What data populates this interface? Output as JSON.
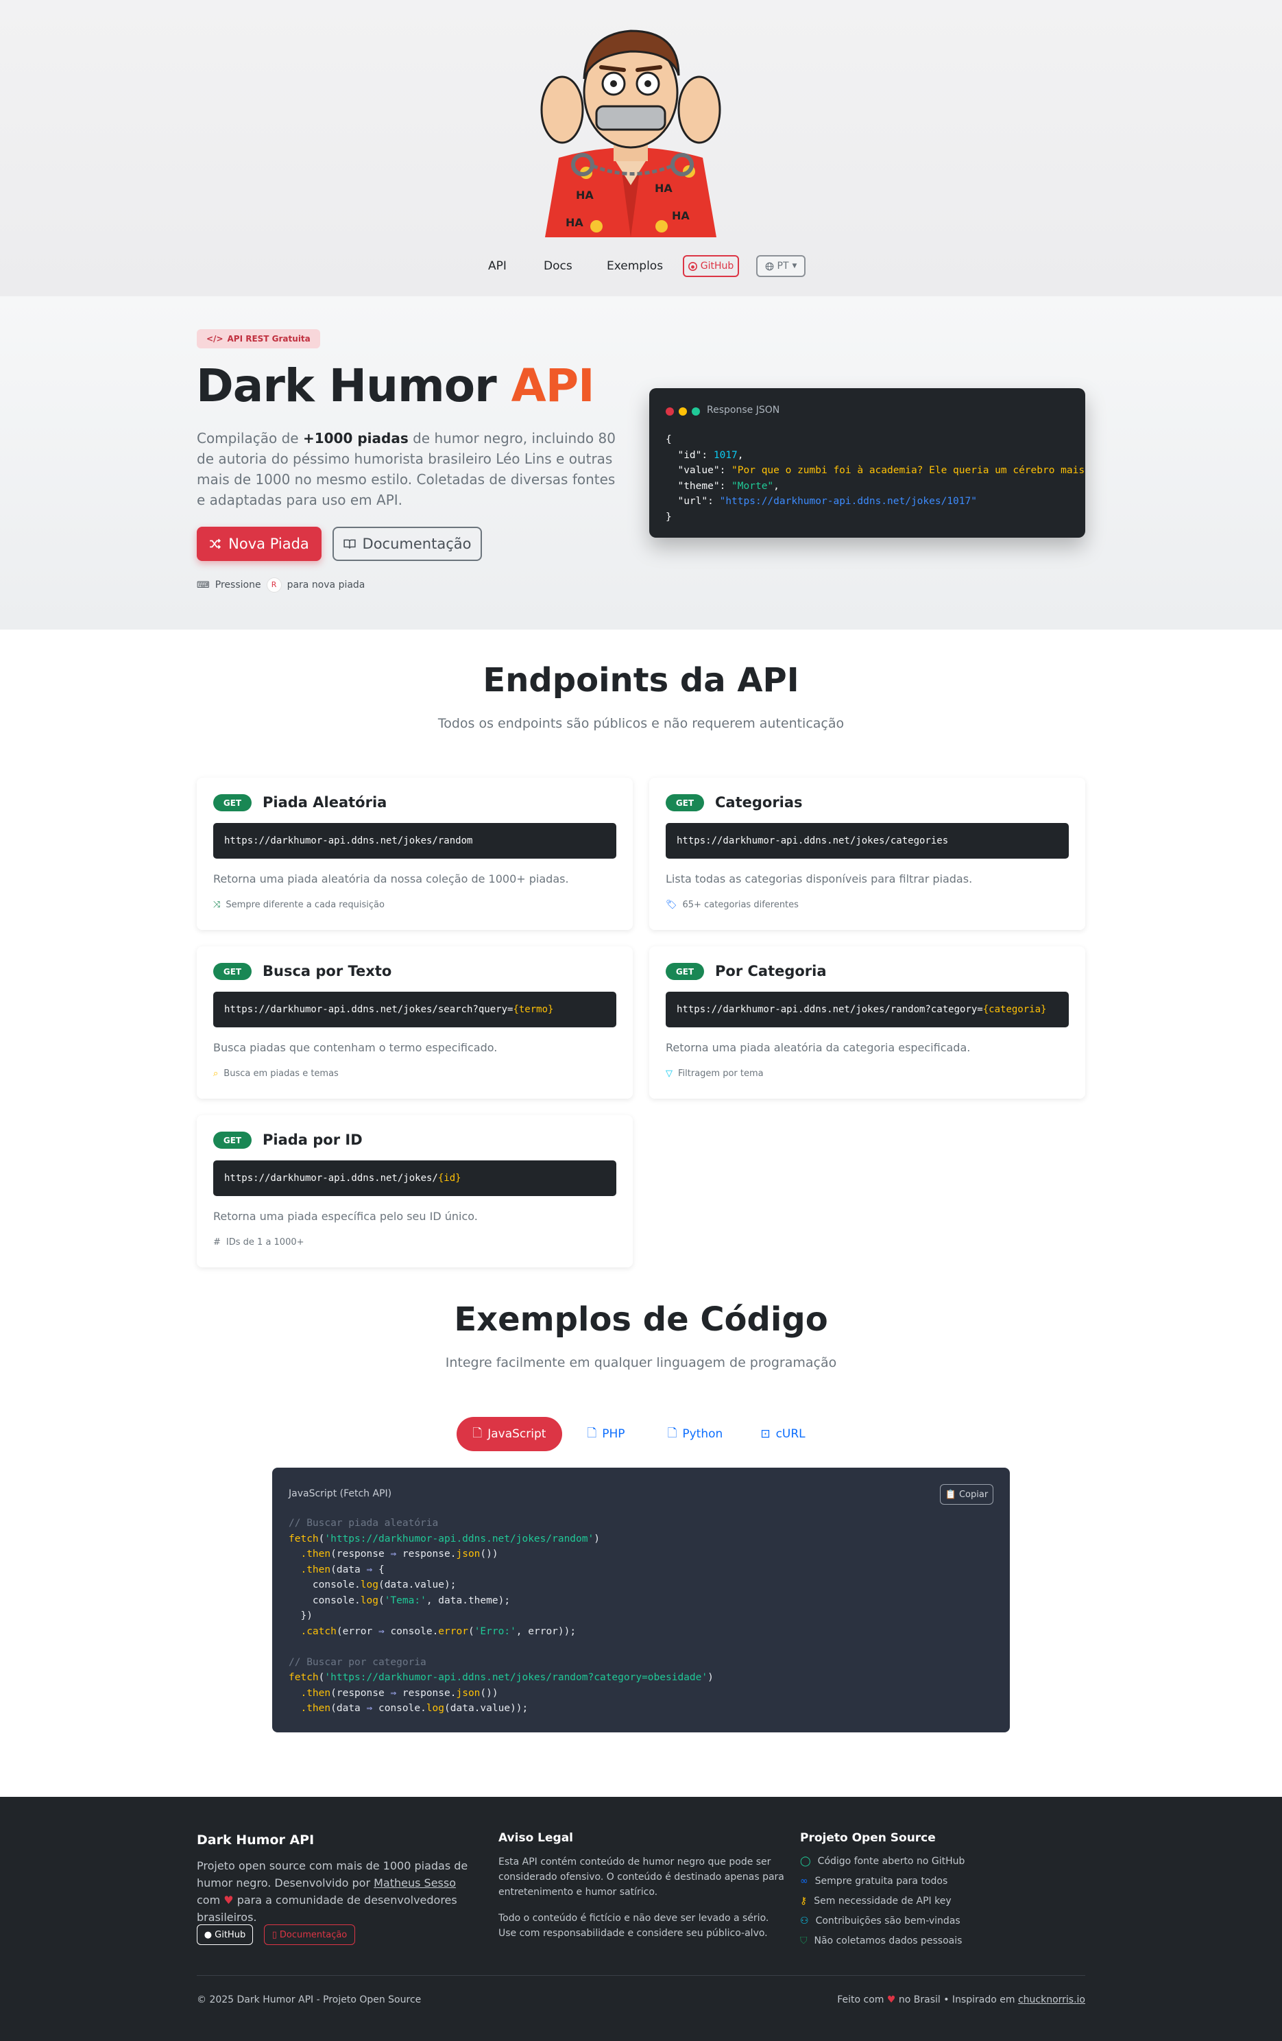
{
  "nav": {
    "links": [
      "API",
      "Docs",
      "Exemplos"
    ],
    "github": "GitHub",
    "language": "PT"
  },
  "hero": {
    "badge": "API REST Gratuita",
    "title_main": "Dark Humor ",
    "title_accent": "API",
    "lead_pre": "Compilação de ",
    "lead_bold": "+1000 piadas",
    "lead_post": " de humor negro, incluindo 80 de autoria do péssimo humorista brasileiro Léo Lins e outras mais de 1000 no mesmo estilo. Coletadas de diversas fontes e adaptadas para uso em API.",
    "btn_primary": "Nova Piada",
    "btn_secondary": "Documentação",
    "hint_pre": "Pressione",
    "hint_key": "R",
    "hint_post": "para nova piada"
  },
  "json_card": {
    "title": "Response JSON",
    "open": "{",
    "id_key": "\"id\"",
    "id_val": "1017",
    "value_key": "\"value\"",
    "value_val": "\"Por que o zumbi foi à academia? Ele queria um cérebro mais",
    "theme_key": "\"theme\"",
    "theme_val": "\"Morte\"",
    "url_key": "\"url\"",
    "url_val": "\"https://darkhumor-api.ddns.net/jokes/1017\"",
    "close": "}"
  },
  "endpoints": {
    "title": "Endpoints da API",
    "subtitle": "Todos os endpoints são públicos e não requerem autenticação",
    "method": "GET",
    "items": [
      {
        "title": "Piada Aleatória",
        "url": "https://darkhumor-api.ddns.net/jokes/random",
        "param": "",
        "desc": "Retorna uma piada aleatória da nossa coleção de 1000+ piadas.",
        "meta": "Sempre diferente a cada requisição"
      },
      {
        "title": "Categorias",
        "url": "https://darkhumor-api.ddns.net/jokes/categories",
        "param": "",
        "desc": "Lista todas as categorias disponíveis para filtrar piadas.",
        "meta": "65+ categorias diferentes"
      },
      {
        "title": "Busca por Texto",
        "url": "https://darkhumor-api.ddns.net/jokes/search?query=",
        "param": "{termo}",
        "desc": "Busca piadas que contenham o termo especificado.",
        "meta": "Busca em piadas e temas"
      },
      {
        "title": "Por Categoria",
        "url": "https://darkhumor-api.ddns.net/jokes/random?category=",
        "param": "{categoria}",
        "desc": "Retorna uma piada aleatória da categoria especificada.",
        "meta": "Filtragem por tema"
      },
      {
        "title": "Piada por ID",
        "url": "https://darkhumor-api.ddns.net/jokes/",
        "param": "{id}",
        "desc": "Retorna uma piada específica pelo seu ID único.",
        "meta": "IDs de 1 a 1000+"
      }
    ]
  },
  "examples": {
    "title": "Exemplos de Código",
    "subtitle": "Integre facilmente em qualquer linguagem de programação",
    "tabs": [
      "JavaScript",
      "PHP",
      "Python",
      "cURL"
    ],
    "code_title": "JavaScript (Fetch API)",
    "copy": "Copiar",
    "c1": "// Buscar piada aleatória",
    "l_fetch": "fetch",
    "s_url1": "'https://darkhumor-api.ddns.net/jokes/random'",
    "l_then": ".then",
    "l_response": "response",
    "l_json": "json",
    "l_data": "data",
    "l_console": "console",
    "l_log": "log",
    "s_tema": "'Tema:'",
    "l_catch": ".catch",
    "l_error": "error",
    "s_erro": "'Erro:'",
    "c2": "// Buscar por categoria",
    "s_url2": "'https://darkhumor-api.ddns.net/jokes/random?category=obesidade'",
    "t_value": "value",
    "t_theme": "theme"
  },
  "footer": {
    "about_title": "Dark Humor API",
    "about_pre": "Projeto open source com mais de 1000 piadas de humor negro. Desenvolvido por ",
    "about_author": "Matheus Sesso",
    "about_mid": " com ",
    "about_post": " para a comunidade de desenvolvedores brasileiros.",
    "btn_github": "GitHub",
    "btn_docs": "Documentação",
    "legal_title": "Aviso Legal",
    "legal_p1": "Esta API contém conteúdo de humor negro que pode ser considerado ofensivo. O conteúdo é destinado apenas para entretenimento e humor satírico.",
    "legal_p2": "Todo o conteúdo é fictício e não deve ser levado a sério. Use com responsabilidade e considere seu público-alvo.",
    "os_title": "Projeto Open Source",
    "os_items": [
      "Código fonte aberto no GitHub",
      "Sempre gratuita para todos",
      "Sem necessidade de API key",
      "Contribuições são bem-vindas",
      "Não coletamos dados pessoais"
    ],
    "copyright": "© 2025 Dark Humor API - Projeto Open Source",
    "made_pre": "Feito com",
    "made_mid": "no Brasil • Inspirado em",
    "made_link": "chucknorris.io"
  },
  "colors": {
    "accent_red": "#dc3545",
    "accent_orange": "#f05a28",
    "get_green": "#198754",
    "dark": "#212529"
  }
}
